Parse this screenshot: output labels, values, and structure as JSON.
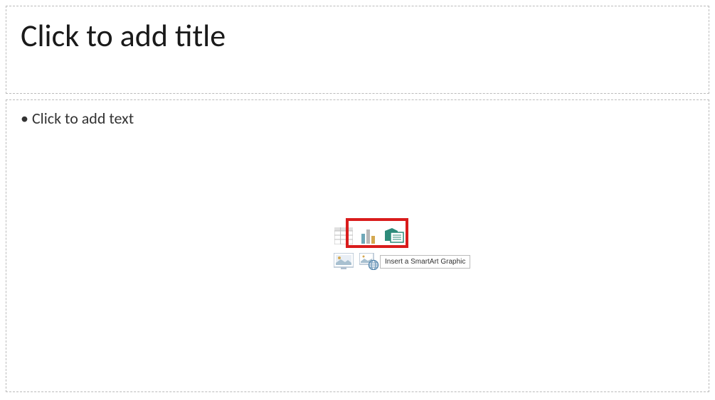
{
  "title": {
    "placeholder": "Click to add title"
  },
  "content": {
    "placeholder": "Click to add text"
  },
  "icons": {
    "table": "table-icon",
    "chart": "chart-icon",
    "smartart": "smartart-icon",
    "pictures": "pictures-icon",
    "onlinepictures": "online-pictures-icon",
    "video": "video-icon"
  },
  "tooltip": {
    "text": "Insert a SmartArt Graphic"
  }
}
